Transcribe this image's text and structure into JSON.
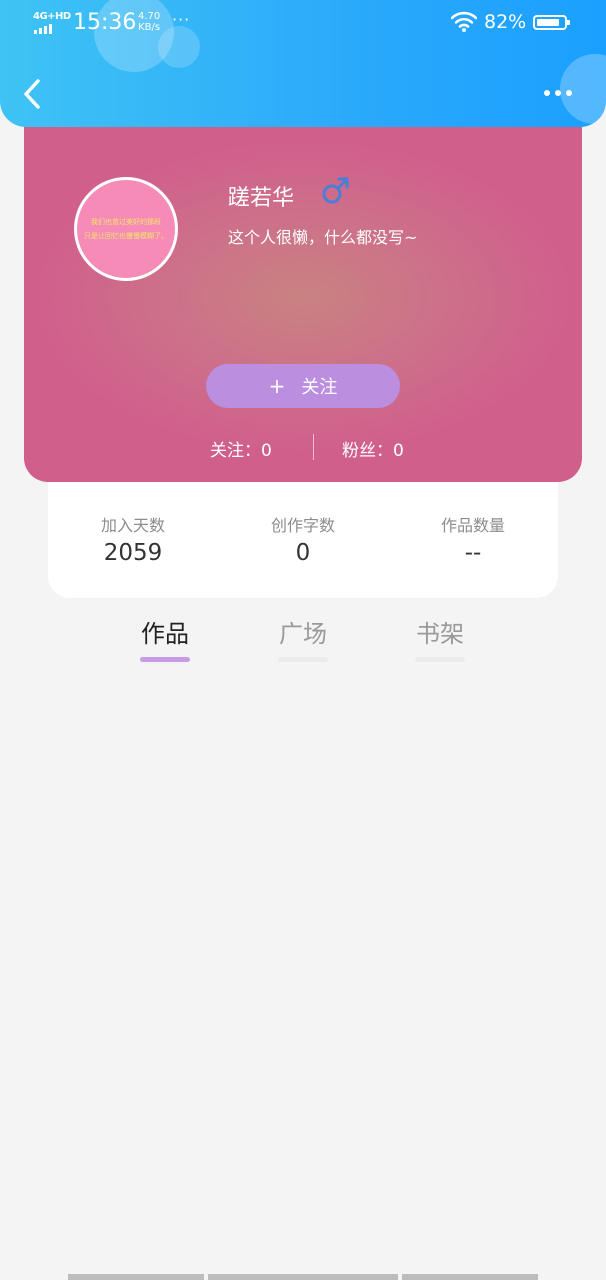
{
  "status_bar": {
    "network": "4G+HD",
    "time": "15:36",
    "speed_value": "4.70",
    "speed_unit": "KB/s",
    "more_indicator": "···",
    "battery_percent": "82%",
    "battery_level": 0.82
  },
  "profile": {
    "username": "蹉若华",
    "gender_icon": "male-symbol-icon",
    "bio": "这个人很懒，什么都没写~",
    "avatar_text": [
      "我们也曾过美好的那段",
      "只是让回忆也慢慢模糊了。"
    ],
    "follow_button": {
      "icon": "+",
      "label": "关注"
    },
    "following_label": "关注：",
    "following_count": "0",
    "fans_label": "粉丝：",
    "fans_count": "0"
  },
  "info": [
    {
      "label": "加入天数",
      "value": "2059"
    },
    {
      "label": "创作字数",
      "value": "0"
    },
    {
      "label": "作品数量",
      "value": "--"
    }
  ],
  "tabs": [
    {
      "label": "作品",
      "active": true
    },
    {
      "label": "广场",
      "active": false
    },
    {
      "label": "书架",
      "active": false
    }
  ],
  "colors": {
    "header_gradient_start": "#3fc3f4",
    "header_gradient_end": "#1aa0ff",
    "card_pink": "#d05f8c",
    "follow_button": "#bb8ee0",
    "active_tab_underline": "#c79be8",
    "gender_icon": "#4a7fd6"
  }
}
